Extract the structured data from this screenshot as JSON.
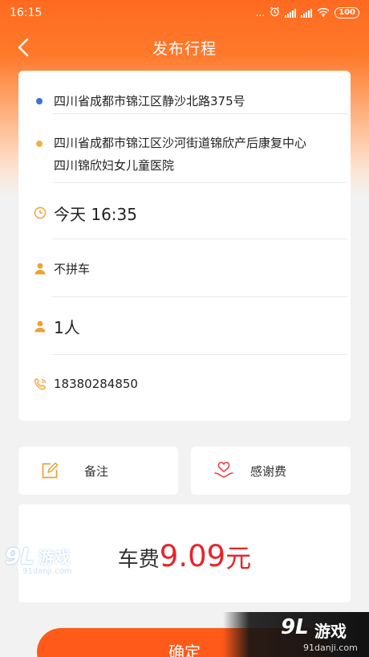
{
  "status_bar": {
    "time": "16:15",
    "dots": "...",
    "battery": "100"
  },
  "header": {
    "title": "发布行程"
  },
  "trip": {
    "origin": "四川省成都市锦江区静沙北路375号",
    "destination_line1": "四川省成都市锦江区沙河街道锦欣产后康复中心",
    "destination_line2": "四川锦欣妇女儿童医院",
    "time": "今天 16:35",
    "carpool": "不拼车",
    "passengers": "1人",
    "phone": "18380284850"
  },
  "options": {
    "note_label": "备注",
    "thanks_fee_label": "感谢费"
  },
  "fare": {
    "label": "车费",
    "amount": "9.09",
    "unit": "元"
  },
  "actions": {
    "confirm_label": "确定"
  },
  "watermark": {
    "logo": "9L",
    "name": "游戏",
    "url": "91danji.com"
  },
  "colors": {
    "accent": "#ff5a1a",
    "origin_dot": "#3b6fe0",
    "destination_dot": "#f0b04a",
    "icon": "#f0a030",
    "fare": "#e8242a"
  }
}
